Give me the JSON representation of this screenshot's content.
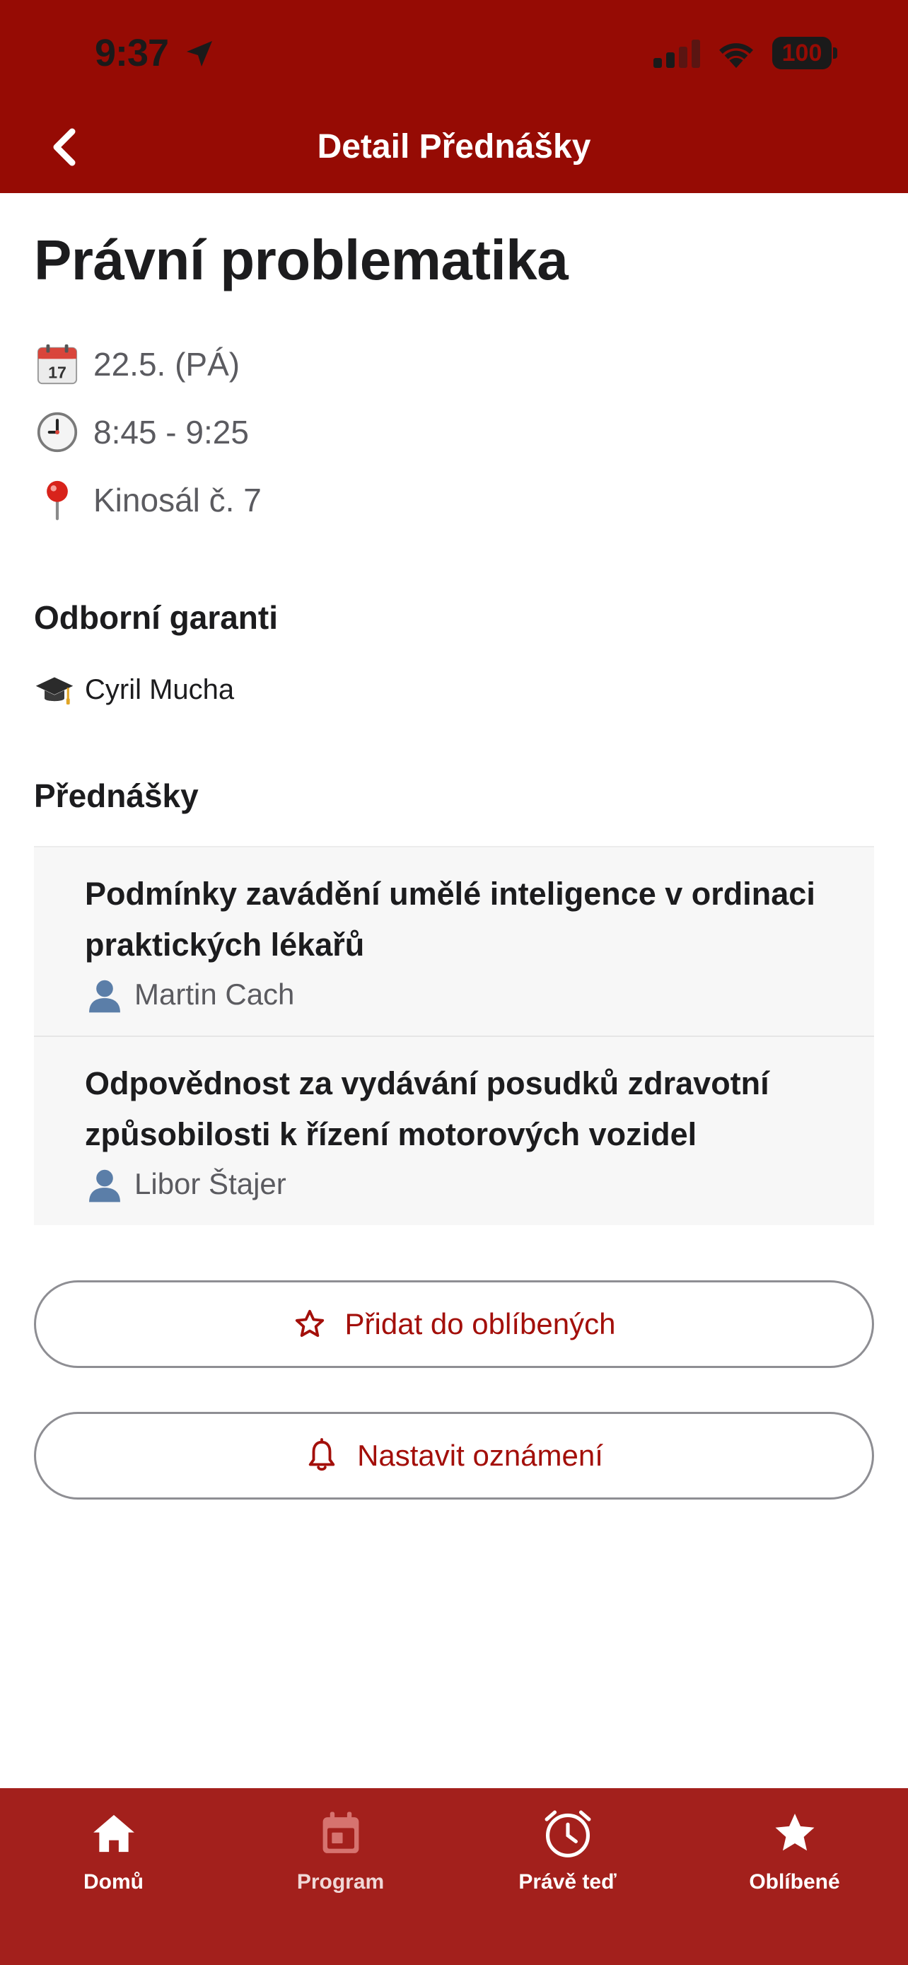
{
  "status_bar": {
    "time": "9:37",
    "battery": "100",
    "icons": [
      "location-arrow-icon",
      "cellular-signal-icon",
      "wifi-icon",
      "battery-icon"
    ]
  },
  "header": {
    "title": "Detail Přednášky",
    "back_icon": "chevron-left-icon"
  },
  "event": {
    "title": "Právní problematika",
    "date": "22.5. (PÁ)",
    "date_icon": "calendar-icon",
    "time": "8:45 - 9:25",
    "time_icon": "clock-icon",
    "place": "Kinosál č. 7",
    "place_icon": "pin-icon"
  },
  "garanti": {
    "heading": "Odborní garanti",
    "items": [
      {
        "name": "Cyril Mucha",
        "icon": "graduation-cap-icon"
      }
    ]
  },
  "prednasky": {
    "heading": "Přednášky",
    "items": [
      {
        "title": "Podmínky zavádění umělé inteligence v ordinaci praktických lékařů",
        "speaker": "Martin Cach",
        "icon": "person-icon"
      },
      {
        "title": "Odpovědnost za vydávání posudků zdravotní způsobilosti k řízení motorových vozidel",
        "speaker": "Libor Štajer",
        "icon": "person-icon"
      }
    ]
  },
  "actions": {
    "favorite_label": "Přidat do oblíbených",
    "favorite_icon": "star-outline-icon",
    "notify_label": "Nastavit oznámení",
    "notify_icon": "bell-icon"
  },
  "tabbar": {
    "items": [
      {
        "label": "Domů",
        "icon": "home-icon"
      },
      {
        "label": "Program",
        "icon": "calendar-icon"
      },
      {
        "label": "Právě teď",
        "icon": "alarm-clock-icon"
      },
      {
        "label": "Oblíbené",
        "icon": "star-icon"
      }
    ]
  },
  "colors": {
    "header": "#960b04",
    "tabbar": "#a3201c",
    "accent_text": "#a30f0a",
    "list_background": "#f7f7f7"
  }
}
